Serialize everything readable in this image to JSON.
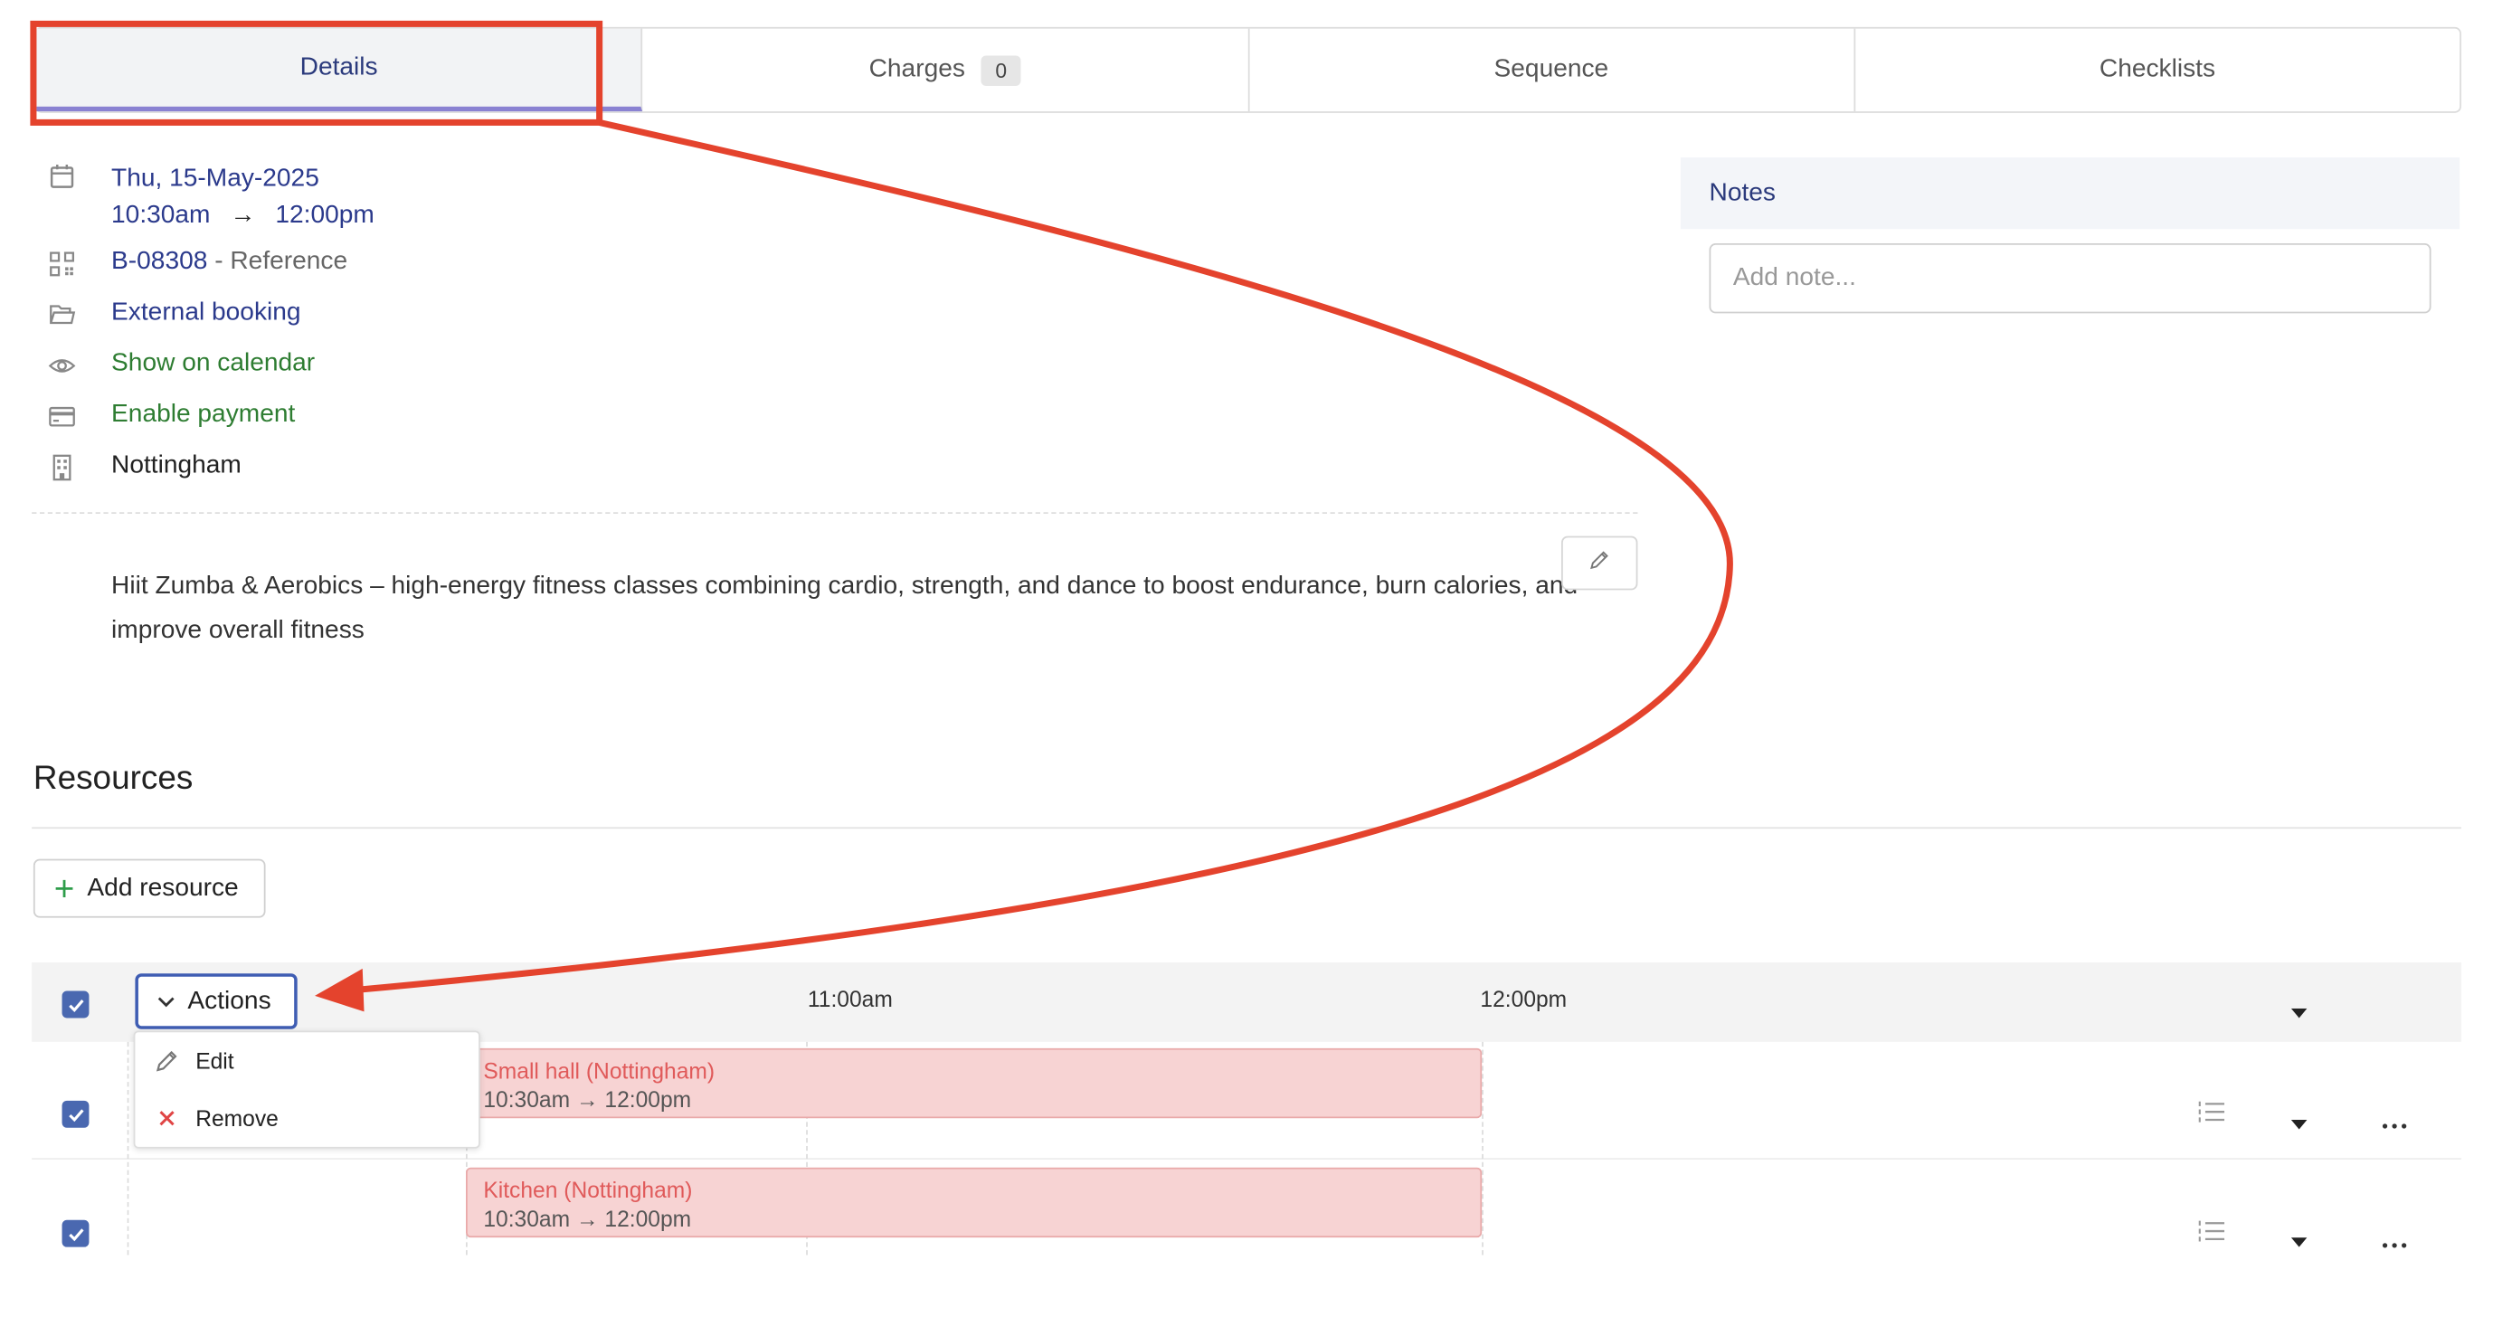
{
  "tabs": [
    {
      "label": "Details",
      "active": true
    },
    {
      "label": "Charges",
      "badge": "0"
    },
    {
      "label": "Sequence"
    },
    {
      "label": "Checklists"
    }
  ],
  "details": {
    "date": "Thu, 15-May-2025",
    "time_start": "10:30am",
    "time_arrow": "→",
    "time_end": "12:00pm",
    "reference_code": "B-08308",
    "reference_suffix": " - Reference",
    "booking_type": "External booking",
    "show_on_calendar": "Show on calendar",
    "enable_payment": "Enable payment",
    "location": "Nottingham",
    "description": "Hiit Zumba & Aerobics – high-energy fitness classes combining cardio, strength, and dance to boost endurance, burn calories, and improve overall fitness"
  },
  "notes": {
    "title": "Notes",
    "placeholder": "Add note..."
  },
  "resources": {
    "title": "Resources",
    "add_label": "Add resource",
    "actions_label": "Actions",
    "time_labels": [
      "11:00am",
      "12:00pm"
    ],
    "menu": {
      "edit": "Edit",
      "remove": "Remove"
    },
    "rows": [
      {
        "name": "Small hall (Nottingham)",
        "time": "10:30am → 12:00pm"
      },
      {
        "name": "Kitchen (Nottingham)",
        "time": "10:30am → 12:00pm"
      }
    ]
  },
  "colors": {
    "annotation": "#e4432d",
    "accent": "#2b3a8c",
    "checkbox": "#4a68b0",
    "booking_fill": "#f7d3d3"
  }
}
